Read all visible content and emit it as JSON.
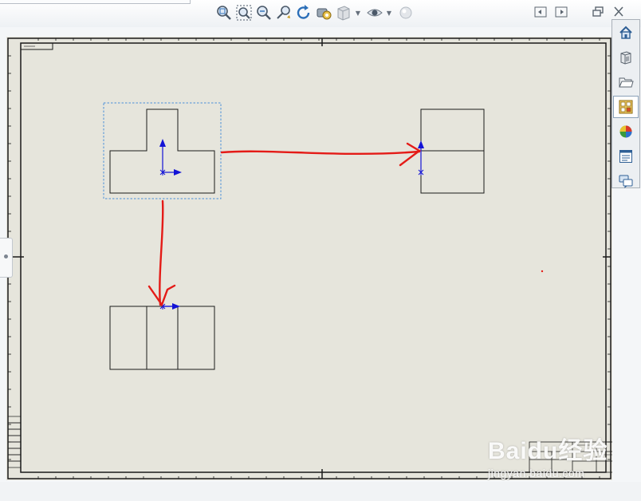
{
  "app": {
    "name": "SolidWorks drawing sheet"
  },
  "heads_up_toolbar": {
    "tools": [
      {
        "id": "zoom-to-fit",
        "icon": "zoom-to-fit-icon"
      },
      {
        "id": "zoom-to-area",
        "icon": "zoom-area-icon"
      },
      {
        "id": "zoom-in-out",
        "icon": "zoom-in-out-icon"
      },
      {
        "id": "zoom-to-selection",
        "icon": "zoom-selection-icon"
      },
      {
        "id": "rotate-view",
        "icon": "rotate-view-icon"
      },
      {
        "id": "pan",
        "icon": "pan-icon"
      },
      {
        "id": "display-style",
        "icon": "display-style-icon",
        "has_dropdown": true
      },
      {
        "id": "hide-show-items",
        "icon": "eye-icon",
        "has_dropdown": true
      },
      {
        "id": "apply-scene",
        "icon": "scene-sphere-icon"
      }
    ]
  },
  "window_controls": [
    "tile-left-icon",
    "tile-right-icon",
    "restore-icon",
    "close-icon"
  ],
  "task_pane": {
    "buttons": [
      {
        "id": "solidworks-resources",
        "icon": "home-icon",
        "active": false
      },
      {
        "id": "design-library",
        "icon": "design-library-icon",
        "active": false
      },
      {
        "id": "file-explorer",
        "icon": "folder-icon",
        "active": false
      },
      {
        "id": "view-palette",
        "icon": "view-palette-icon",
        "active": true
      },
      {
        "id": "appearances",
        "icon": "appearances-icon",
        "active": false
      },
      {
        "id": "custom-properties",
        "icon": "custom-properties-icon",
        "active": false
      },
      {
        "id": "forum",
        "icon": "forum-icon",
        "active": false
      }
    ]
  },
  "drawing": {
    "views": [
      {
        "name": "front-view",
        "shape": "inverted-t",
        "selected": true
      },
      {
        "name": "side-view",
        "shape": "rectangle-split-horizontal",
        "selected": false
      },
      {
        "name": "top-view",
        "shape": "rectangle-split-vertical-3",
        "selected": false
      }
    ],
    "annotations": [
      {
        "name": "arrow-front-to-side",
        "color": "#e41b17"
      },
      {
        "name": "arrow-front-to-top",
        "color": "#e41b17"
      }
    ],
    "colors": {
      "sheet": "#e6e5dc",
      "geometry": "#1a1a1a",
      "origin_axis": "#1313d6",
      "selection_box": "#4a90d9",
      "markup": "#e41b17"
    }
  },
  "watermark": {
    "logo": "Baidu经验",
    "url": "jingyan.baidu.com"
  }
}
